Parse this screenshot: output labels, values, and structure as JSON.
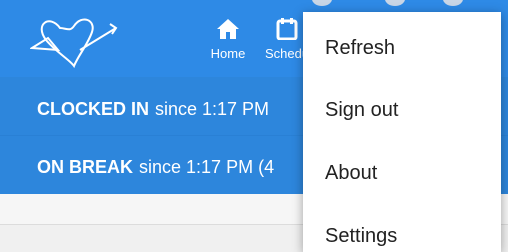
{
  "nav": {
    "items": [
      {
        "label": "Home",
        "icon": "home-icon"
      },
      {
        "label": "Schedule",
        "icon": "calendar-icon"
      }
    ]
  },
  "status": {
    "clocked_in_label": "CLOCKED IN",
    "clocked_in_text": "since 1:17 PM",
    "on_break_label": "ON BREAK",
    "on_break_text": "since 1:17 PM (4"
  },
  "menu": {
    "items": [
      "Refresh",
      "Sign out",
      "About",
      "Settings"
    ]
  },
  "colors": {
    "header_blue": "#2e8ae6",
    "panel_blue": "#2d86dc",
    "menu_bg": "#ffffff"
  }
}
